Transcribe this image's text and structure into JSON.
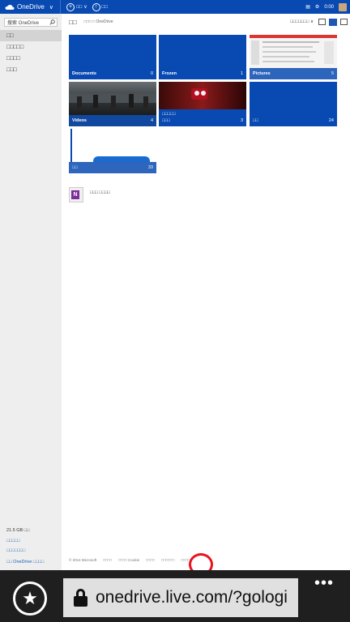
{
  "topbar": {
    "brand": "OneDrive",
    "create_label": "□□",
    "upload_label": "□□",
    "time": "0:00"
  },
  "sidebar": {
    "search_placeholder": "搜索 OneDrive",
    "items": [
      {
        "label": "□□",
        "active": true
      },
      {
        "label": "□□□□□"
      },
      {
        "label": "□□□□"
      },
      {
        "label": "□□□"
      }
    ],
    "storage": "21.5 GB □□",
    "links": [
      "□□□□□",
      "□□□□□□□",
      "□□ OneDrive □□□□"
    ]
  },
  "main": {
    "title": "□□",
    "breadcrumb": "□□□ □ OneDrive",
    "sort_label": "□□□□□□□ ∨",
    "tiles": [
      {
        "label": "Documents",
        "count": "0"
      },
      {
        "label": "Frozen",
        "count": "1"
      },
      {
        "label": "Pictures",
        "count": "5"
      },
      {
        "label": "Videos",
        "count": "4"
      },
      {
        "label": "□□□□□",
        "sublabel": "□□□",
        "count": "3"
      },
      {
        "label": "□□",
        "count": "24"
      },
      {
        "label": "□□",
        "count": "33"
      }
    ],
    "files": [
      {
        "name": "□□□ □□□□"
      }
    ]
  },
  "footer": {
    "links": [
      "© 2014 Microsoft",
      "□□□□",
      "□□□□ Cookie",
      "□□□□",
      "□□□□□□",
      "□□□□"
    ]
  },
  "browser": {
    "url": "onedrive.live.com/?gologi",
    "more_label": "•••"
  },
  "colors": {
    "accent": "#094ab2",
    "sidebar_bg": "#eeeeee",
    "annotation": "#e8141e"
  }
}
